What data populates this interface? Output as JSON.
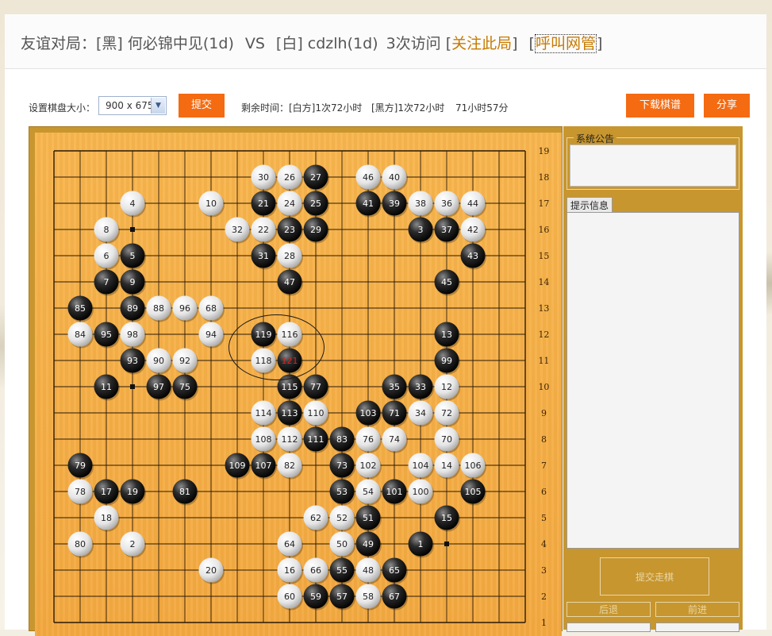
{
  "title": {
    "prefix": "友谊对局：",
    "black_player": "[黑] 何必锦中见(1d)",
    "vs": "VS",
    "white_player": "[白] cdzlh(1d)",
    "visits": "3次访问",
    "follow_link": "关注此局",
    "call_admin": "呼叫网管"
  },
  "toolbar": {
    "board_size_label": "设置棋盘大小：",
    "board_size_value": "900 x 675",
    "submit_label": "提交",
    "time_label": "剩余时间：",
    "white_time": "[白方]1次72小时",
    "black_time": "[黑方]1次72小时",
    "elapsed": "71小时57分",
    "download_label": "下载棋谱",
    "share_label": "分享"
  },
  "side": {
    "announcement_legend": "系统公告",
    "hint_tab": "提示信息",
    "submit_move_label": "提交走棋",
    "back_label": "后退",
    "forward_label": "前进"
  },
  "colors": {
    "accent": "#f46b12",
    "board": "#f7b04a",
    "frame": "#c8962f",
    "link": "#c77a00"
  },
  "board": {
    "size": 19,
    "row_labels": [
      "19",
      "18",
      "17",
      "16",
      "15",
      "14",
      "13",
      "12",
      "11",
      "10",
      "9",
      "8",
      "7",
      "6",
      "5",
      "4",
      "3",
      "2",
      "1"
    ],
    "last_move": 121,
    "highlight_circle": "around moves 116, 118, 119, 121",
    "stones": [
      {
        "n": 1,
        "c": "B",
        "col": 15,
        "row": 4
      },
      {
        "n": 2,
        "c": "W",
        "col": 4,
        "row": 4
      },
      {
        "n": 3,
        "c": "B",
        "col": 15,
        "row": 16
      },
      {
        "n": 4,
        "c": "W",
        "col": 4,
        "row": 17
      },
      {
        "n": 5,
        "c": "B",
        "col": 4,
        "row": 15
      },
      {
        "n": 6,
        "c": "W",
        "col": 3,
        "row": 15
      },
      {
        "n": 7,
        "c": "B",
        "col": 3,
        "row": 14
      },
      {
        "n": 8,
        "c": "W",
        "col": 3,
        "row": 16
      },
      {
        "n": 9,
        "c": "B",
        "col": 4,
        "row": 14
      },
      {
        "n": 10,
        "c": "W",
        "col": 7,
        "row": 17
      },
      {
        "n": 11,
        "c": "B",
        "col": 3,
        "row": 10
      },
      {
        "n": 12,
        "c": "W",
        "col": 16,
        "row": 10
      },
      {
        "n": 13,
        "c": "B",
        "col": 16,
        "row": 12
      },
      {
        "n": 14,
        "c": "W",
        "col": 16,
        "row": 7
      },
      {
        "n": 15,
        "c": "B",
        "col": 16,
        "row": 5
      },
      {
        "n": 16,
        "c": "W",
        "col": 10,
        "row": 3
      },
      {
        "n": 17,
        "c": "B",
        "col": 3,
        "row": 6
      },
      {
        "n": 18,
        "c": "W",
        "col": 3,
        "row": 5
      },
      {
        "n": 19,
        "c": "B",
        "col": 4,
        "row": 6
      },
      {
        "n": 20,
        "c": "W",
        "col": 7,
        "row": 3
      },
      {
        "n": 21,
        "c": "B",
        "col": 9,
        "row": 17
      },
      {
        "n": 22,
        "c": "W",
        "col": 9,
        "row": 16
      },
      {
        "n": 23,
        "c": "B",
        "col": 10,
        "row": 16
      },
      {
        "n": 24,
        "c": "W",
        "col": 10,
        "row": 17
      },
      {
        "n": 25,
        "c": "B",
        "col": 11,
        "row": 17
      },
      {
        "n": 26,
        "c": "W",
        "col": 10,
        "row": 18
      },
      {
        "n": 27,
        "c": "B",
        "col": 11,
        "row": 18
      },
      {
        "n": 28,
        "c": "W",
        "col": 10,
        "row": 15
      },
      {
        "n": 29,
        "c": "B",
        "col": 11,
        "row": 16
      },
      {
        "n": 30,
        "c": "W",
        "col": 9,
        "row": 18
      },
      {
        "n": 31,
        "c": "B",
        "col": 9,
        "row": 15
      },
      {
        "n": 32,
        "c": "W",
        "col": 8,
        "row": 16
      },
      {
        "n": 33,
        "c": "B",
        "col": 15,
        "row": 10
      },
      {
        "n": 34,
        "c": "W",
        "col": 15,
        "row": 9
      },
      {
        "n": 35,
        "c": "B",
        "col": 14,
        "row": 10
      },
      {
        "n": 36,
        "c": "W",
        "col": 16,
        "row": 17
      },
      {
        "n": 37,
        "c": "B",
        "col": 16,
        "row": 16
      },
      {
        "n": 38,
        "c": "W",
        "col": 15,
        "row": 17
      },
      {
        "n": 39,
        "c": "B",
        "col": 14,
        "row": 17
      },
      {
        "n": 40,
        "c": "W",
        "col": 14,
        "row": 18
      },
      {
        "n": 41,
        "c": "B",
        "col": 13,
        "row": 17
      },
      {
        "n": 42,
        "c": "W",
        "col": 17,
        "row": 16
      },
      {
        "n": 43,
        "c": "B",
        "col": 17,
        "row": 15
      },
      {
        "n": 44,
        "c": "W",
        "col": 17,
        "row": 17
      },
      {
        "n": 45,
        "c": "B",
        "col": 16,
        "row": 14
      },
      {
        "n": 46,
        "c": "W",
        "col": 13,
        "row": 18
      },
      {
        "n": 47,
        "c": "B",
        "col": 10,
        "row": 14
      },
      {
        "n": 48,
        "c": "W",
        "col": 13,
        "row": 3
      },
      {
        "n": 49,
        "c": "B",
        "col": 13,
        "row": 4
      },
      {
        "n": 50,
        "c": "W",
        "col": 12,
        "row": 4
      },
      {
        "n": 51,
        "c": "B",
        "col": 13,
        "row": 5
      },
      {
        "n": 52,
        "c": "W",
        "col": 12,
        "row": 5
      },
      {
        "n": 53,
        "c": "B",
        "col": 12,
        "row": 6
      },
      {
        "n": 54,
        "c": "W",
        "col": 13,
        "row": 6
      },
      {
        "n": 55,
        "c": "B",
        "col": 12,
        "row": 3
      },
      {
        "n": 57,
        "c": "B",
        "col": 12,
        "row": 2
      },
      {
        "n": 58,
        "c": "W",
        "col": 13,
        "row": 2
      },
      {
        "n": 59,
        "c": "B",
        "col": 11,
        "row": 2
      },
      {
        "n": 60,
        "c": "W",
        "col": 10,
        "row": 2
      },
      {
        "n": 62,
        "c": "W",
        "col": 11,
        "row": 5
      },
      {
        "n": 64,
        "c": "W",
        "col": 10,
        "row": 4
      },
      {
        "n": 65,
        "c": "B",
        "col": 14,
        "row": 3
      },
      {
        "n": 66,
        "c": "W",
        "col": 11,
        "row": 3
      },
      {
        "n": 67,
        "c": "B",
        "col": 14,
        "row": 2
      },
      {
        "n": 68,
        "c": "W",
        "col": 7,
        "row": 13
      },
      {
        "n": 70,
        "c": "W",
        "col": 16,
        "row": 8
      },
      {
        "n": 71,
        "c": "B",
        "col": 14,
        "row": 9
      },
      {
        "n": 72,
        "c": "W",
        "col": 16,
        "row": 9
      },
      {
        "n": 73,
        "c": "B",
        "col": 12,
        "row": 7
      },
      {
        "n": 74,
        "c": "W",
        "col": 14,
        "row": 8
      },
      {
        "n": 75,
        "c": "B",
        "col": 6,
        "row": 10
      },
      {
        "n": 76,
        "c": "W",
        "col": 13,
        "row": 8
      },
      {
        "n": 77,
        "c": "B",
        "col": 11,
        "row": 10
      },
      {
        "n": 78,
        "c": "W",
        "col": 2,
        "row": 6
      },
      {
        "n": 79,
        "c": "B",
        "col": 2,
        "row": 7
      },
      {
        "n": 80,
        "c": "W",
        "col": 2,
        "row": 4
      },
      {
        "n": 81,
        "c": "B",
        "col": 6,
        "row": 6
      },
      {
        "n": 82,
        "c": "W",
        "col": 10,
        "row": 7
      },
      {
        "n": 83,
        "c": "B",
        "col": 12,
        "row": 8
      },
      {
        "n": 84,
        "c": "W",
        "col": 2,
        "row": 12
      },
      {
        "n": 85,
        "c": "B",
        "col": 2,
        "row": 13
      },
      {
        "n": 88,
        "c": "W",
        "col": 5,
        "row": 13
      },
      {
        "n": 89,
        "c": "B",
        "col": 4,
        "row": 13
      },
      {
        "n": 90,
        "c": "W",
        "col": 5,
        "row": 11
      },
      {
        "n": 92,
        "c": "W",
        "col": 6,
        "row": 11
      },
      {
        "n": 93,
        "c": "B",
        "col": 4,
        "row": 11
      },
      {
        "n": 94,
        "c": "W",
        "col": 7,
        "row": 12
      },
      {
        "n": 95,
        "c": "B",
        "col": 3,
        "row": 12
      },
      {
        "n": 96,
        "c": "W",
        "col": 6,
        "row": 13
      },
      {
        "n": 97,
        "c": "B",
        "col": 5,
        "row": 10
      },
      {
        "n": 98,
        "c": "W",
        "col": 4,
        "row": 12
      },
      {
        "n": 99,
        "c": "B",
        "col": 16,
        "row": 11
      },
      {
        "n": 100,
        "c": "W",
        "col": 15,
        "row": 6
      },
      {
        "n": 101,
        "c": "B",
        "col": 14,
        "row": 6
      },
      {
        "n": 102,
        "c": "W",
        "col": 13,
        "row": 7
      },
      {
        "n": 103,
        "c": "B",
        "col": 13,
        "row": 9
      },
      {
        "n": 104,
        "c": "W",
        "col": 15,
        "row": 7
      },
      {
        "n": 105,
        "c": "B",
        "col": 17,
        "row": 6
      },
      {
        "n": 106,
        "c": "W",
        "col": 17,
        "row": 7
      },
      {
        "n": 107,
        "c": "B",
        "col": 9,
        "row": 7
      },
      {
        "n": 108,
        "c": "W",
        "col": 9,
        "row": 8
      },
      {
        "n": 109,
        "c": "B",
        "col": 8,
        "row": 7
      },
      {
        "n": 110,
        "c": "W",
        "col": 11,
        "row": 9
      },
      {
        "n": 111,
        "c": "B",
        "col": 11,
        "row": 8
      },
      {
        "n": 112,
        "c": "W",
        "col": 10,
        "row": 8
      },
      {
        "n": 113,
        "c": "B",
        "col": 10,
        "row": 9
      },
      {
        "n": 114,
        "c": "W",
        "col": 9,
        "row": 9
      },
      {
        "n": 115,
        "c": "B",
        "col": 10,
        "row": 10
      },
      {
        "n": 116,
        "c": "W",
        "col": 10,
        "row": 12
      },
      {
        "n": 118,
        "c": "W",
        "col": 9,
        "row": 11
      },
      {
        "n": 119,
        "c": "B",
        "col": 9,
        "row": 12
      },
      {
        "n": 121,
        "c": "B",
        "col": 10,
        "row": 11
      }
    ]
  }
}
